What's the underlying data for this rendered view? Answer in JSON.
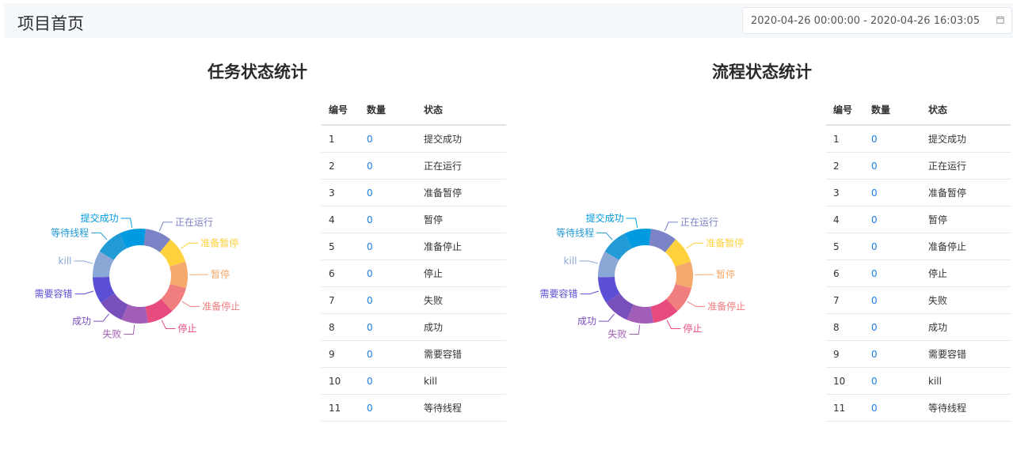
{
  "header": {
    "title": "项目首页",
    "date_range": "2020-04-26 00:00:00 - 2020-04-26 16:03:05",
    "calendar_icon": "calendar-icon"
  },
  "table_headers": {
    "id": "编号",
    "count": "数量",
    "status": "状态"
  },
  "colors": [
    "#009ae0",
    "#7b82c6",
    "#ffd23d",
    "#f4a96d",
    "#f07e7e",
    "#e84b7d",
    "#a25eb6",
    "#784fbb",
    "#5b4fd5",
    "#8aa7d6",
    "#229ad6"
  ],
  "task_section": {
    "title": "任务状态统计",
    "rows": [
      {
        "id": "1",
        "count": "0",
        "status": "提交成功"
      },
      {
        "id": "2",
        "count": "0",
        "status": "正在运行"
      },
      {
        "id": "3",
        "count": "0",
        "status": "准备暂停"
      },
      {
        "id": "4",
        "count": "0",
        "status": "暂停"
      },
      {
        "id": "5",
        "count": "0",
        "status": "准备停止"
      },
      {
        "id": "6",
        "count": "0",
        "status": "停止"
      },
      {
        "id": "7",
        "count": "0",
        "status": "失败"
      },
      {
        "id": "8",
        "count": "0",
        "status": "成功"
      },
      {
        "id": "9",
        "count": "0",
        "status": "需要容错"
      },
      {
        "id": "10",
        "count": "0",
        "status": "kill"
      },
      {
        "id": "11",
        "count": "0",
        "status": "等待线程"
      }
    ]
  },
  "process_section": {
    "title": "流程状态统计",
    "rows": [
      {
        "id": "1",
        "count": "0",
        "status": "提交成功"
      },
      {
        "id": "2",
        "count": "0",
        "status": "正在运行"
      },
      {
        "id": "3",
        "count": "0",
        "status": "准备暂停"
      },
      {
        "id": "4",
        "count": "0",
        "status": "暂停"
      },
      {
        "id": "5",
        "count": "0",
        "status": "准备停止"
      },
      {
        "id": "6",
        "count": "0",
        "status": "停止"
      },
      {
        "id": "7",
        "count": "0",
        "status": "失败"
      },
      {
        "id": "8",
        "count": "0",
        "status": "成功"
      },
      {
        "id": "9",
        "count": "0",
        "status": "需要容错"
      },
      {
        "id": "10",
        "count": "0",
        "status": "kill"
      },
      {
        "id": "11",
        "count": "0",
        "status": "等待线程"
      }
    ]
  },
  "chart_data": [
    {
      "type": "pie",
      "categories": [
        "提交成功",
        "正在运行",
        "准备暂停",
        "暂停",
        "准备停止",
        "停止",
        "失败",
        "成功",
        "需要容错",
        "kill",
        "等待线程"
      ],
      "values": [
        0,
        0,
        0,
        0,
        0,
        0,
        0,
        0,
        0,
        0,
        0
      ],
      "title": "任务状态统计"
    },
    {
      "type": "pie",
      "categories": [
        "提交成功",
        "正在运行",
        "准备暂停",
        "暂停",
        "准备停止",
        "停止",
        "失败",
        "成功",
        "需要容错",
        "kill",
        "等待线程"
      ],
      "values": [
        0,
        0,
        0,
        0,
        0,
        0,
        0,
        0,
        0,
        0,
        0
      ],
      "title": "流程状态统计"
    }
  ]
}
